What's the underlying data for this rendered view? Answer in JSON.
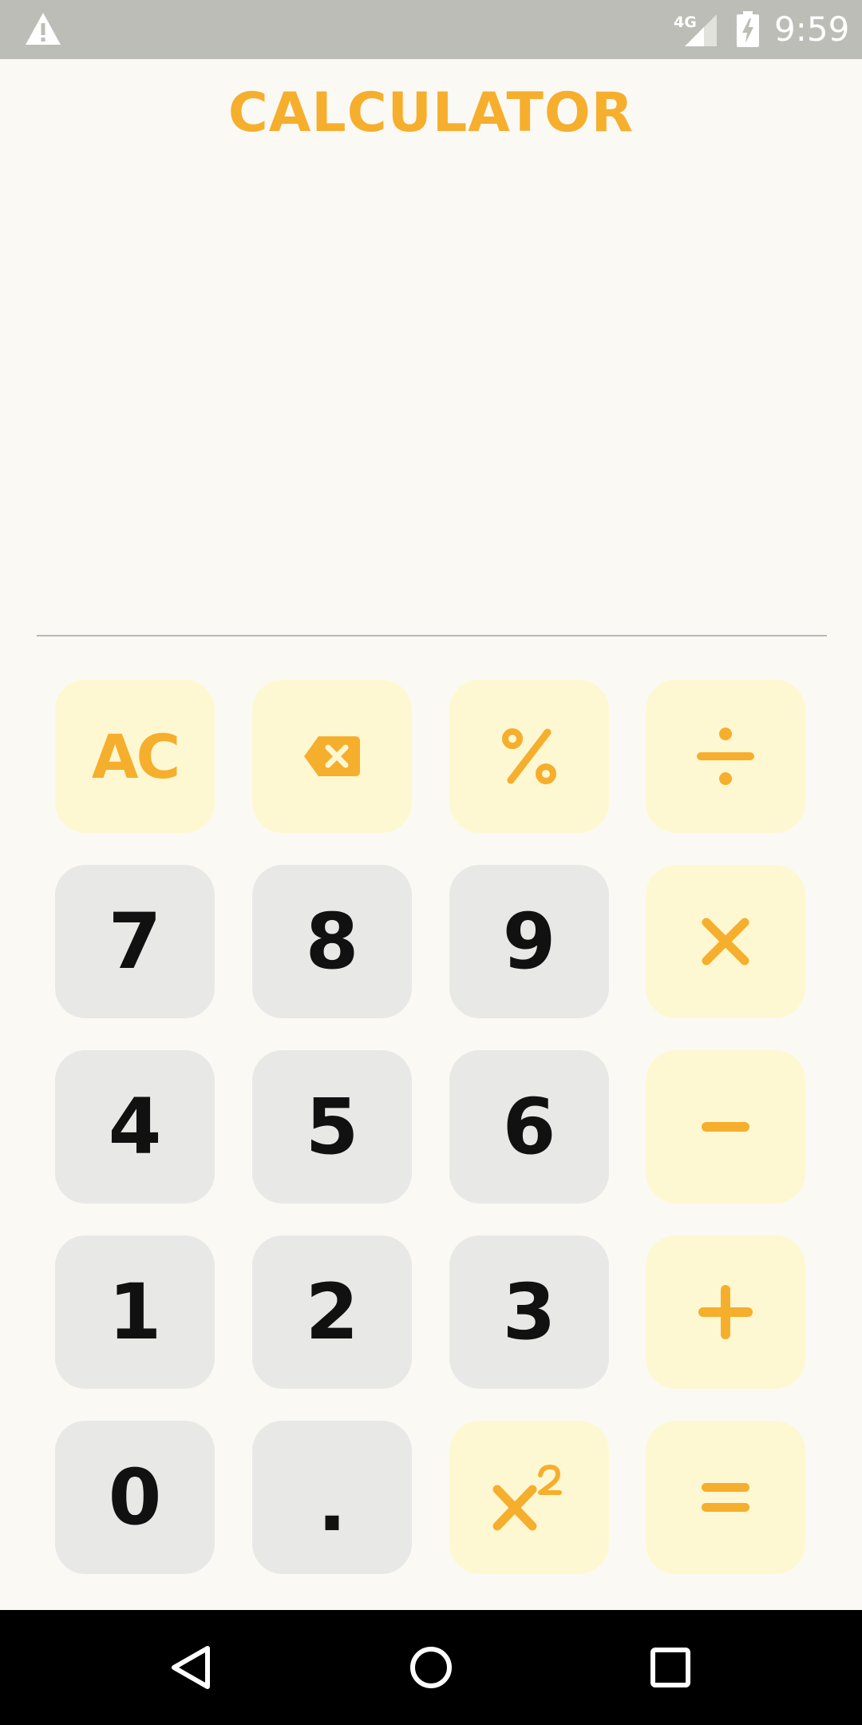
{
  "status_bar": {
    "network_label": "4G",
    "time": "9:59",
    "icons": [
      "warning-icon",
      "cell-signal-icon",
      "battery-charging-icon"
    ]
  },
  "app": {
    "title": "CALCULATOR",
    "display": {
      "expression": "",
      "result": ""
    }
  },
  "keypad": {
    "rows": [
      [
        {
          "name": "all-clear-button",
          "label": "AC",
          "kind": "op"
        },
        {
          "name": "backspace-button",
          "icon": "backspace-icon",
          "kind": "op"
        },
        {
          "name": "percent-button",
          "icon": "percent-icon",
          "kind": "op"
        },
        {
          "name": "divide-button",
          "icon": "divide-icon",
          "kind": "op"
        }
      ],
      [
        {
          "name": "digit-7-button",
          "label": "7",
          "kind": "num"
        },
        {
          "name": "digit-8-button",
          "label": "8",
          "kind": "num"
        },
        {
          "name": "digit-9-button",
          "label": "9",
          "kind": "num"
        },
        {
          "name": "multiply-button",
          "icon": "multiply-icon",
          "kind": "op"
        }
      ],
      [
        {
          "name": "digit-4-button",
          "label": "4",
          "kind": "num"
        },
        {
          "name": "digit-5-button",
          "label": "5",
          "kind": "num"
        },
        {
          "name": "digit-6-button",
          "label": "6",
          "kind": "num"
        },
        {
          "name": "subtract-button",
          "icon": "minus-icon",
          "kind": "op"
        }
      ],
      [
        {
          "name": "digit-1-button",
          "label": "1",
          "kind": "num"
        },
        {
          "name": "digit-2-button",
          "label": "2",
          "kind": "num"
        },
        {
          "name": "digit-3-button",
          "label": "3",
          "kind": "num"
        },
        {
          "name": "add-button",
          "icon": "plus-icon",
          "kind": "op"
        }
      ],
      [
        {
          "name": "digit-0-button",
          "label": "0",
          "kind": "num"
        },
        {
          "name": "decimal-button",
          "label": ".",
          "kind": "num"
        },
        {
          "name": "square-button",
          "icon": "x-squared-icon",
          "kind": "op"
        },
        {
          "name": "equals-button",
          "icon": "equals-icon",
          "kind": "op"
        }
      ]
    ]
  },
  "nav_bar": {
    "icons": [
      "back-icon",
      "home-icon",
      "recents-icon"
    ]
  },
  "colors": {
    "accent": "#f6ae2d",
    "operator_key_bg": "#fef8d2",
    "number_key_bg": "#e8e8e6",
    "background": "#faf9f4",
    "status_bar": "#bdbdb7",
    "nav_bar": "#000000",
    "digit_text": "#111111"
  }
}
